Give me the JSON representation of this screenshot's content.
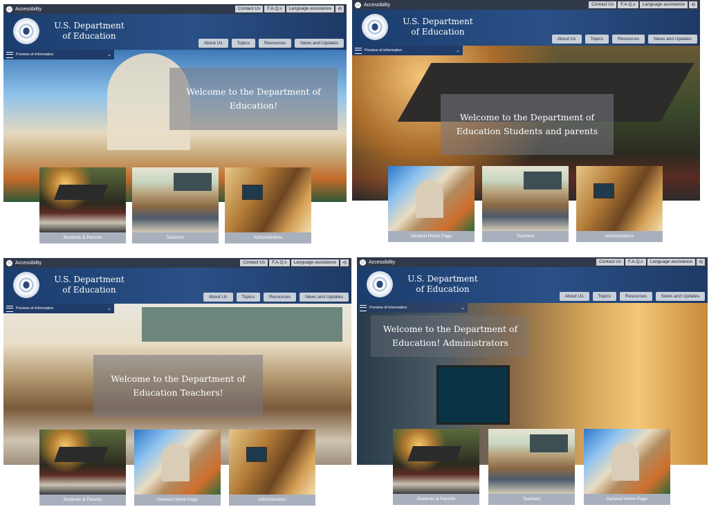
{
  "panels": [
    {
      "topbar": {
        "accessibility": "Accessibility",
        "links": [
          "Contact Us",
          "F.A.Q.s",
          "Language assistance"
        ]
      },
      "header": {
        "title": "U.S. Department of Education",
        "nav": [
          "About Us",
          "Topics",
          "Resources",
          "News and Updates"
        ]
      },
      "preview": "Preview of information",
      "welcome": "Welcome to the Department of Education!",
      "cards": [
        "Students & Parents",
        "Teachers",
        "Administrators"
      ]
    },
    {
      "topbar": {
        "accessibility": "Accessibility",
        "links": [
          "Contact Us",
          "F.A.Q.s",
          "Language assistance"
        ]
      },
      "header": {
        "title": "U.S. Department of Education",
        "nav": [
          "About Us",
          "Topics",
          "Resources",
          "News and Updates"
        ]
      },
      "preview": "Preview of information",
      "welcome": "Welcome to the Department of Education Students and parents",
      "cards": [
        "General Home Page",
        "Teachers",
        "Administrators"
      ]
    },
    {
      "topbar": {
        "accessibility": "Accessibility",
        "links": [
          "Contact Us",
          "F.A.Q.s",
          "Language assistance"
        ]
      },
      "header": {
        "title": "U.S. Department of Education",
        "nav": [
          "About Us",
          "Topics",
          "Resources",
          "News and Updates"
        ]
      },
      "preview": "Preview of information",
      "welcome": "Welcome to the Department of Education Teachers!",
      "cards": [
        "Students & Parents",
        "General Home Page",
        "Administrators"
      ]
    },
    {
      "topbar": {
        "accessibility": "Accessibility",
        "links": [
          "Contact Us",
          "F.A.Q.s",
          "Language assistance"
        ]
      },
      "header": {
        "title": "U.S. Department of Education",
        "nav": [
          "About Us",
          "Topics",
          "Resources",
          "News and Updates"
        ]
      },
      "preview": "Preview of information",
      "welcome": "Welcome to the Department of Education! Administrators",
      "cards": [
        "Students & Parents",
        "Teachers",
        "General Home Page"
      ]
    }
  ]
}
